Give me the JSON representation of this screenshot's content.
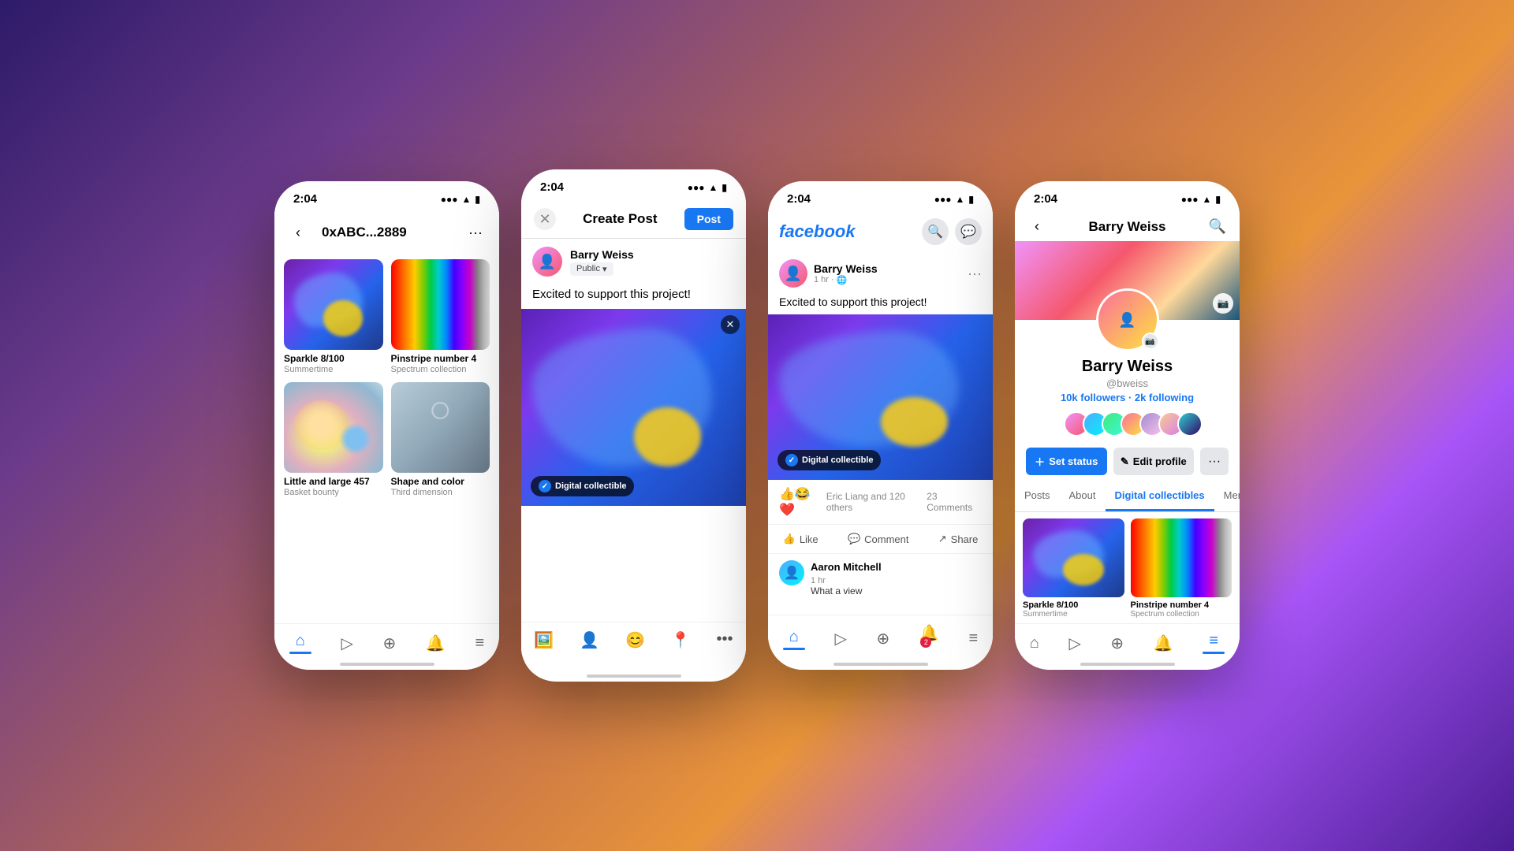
{
  "phones": {
    "phone1": {
      "status_time": "2:04",
      "title": "0xABC...2889",
      "nfts": [
        {
          "title": "Sparkle 8/100",
          "subtitle": "Summertime",
          "type": "blob"
        },
        {
          "title": "Pinstripe number 4",
          "subtitle": "Spectrum collection",
          "type": "stripes"
        },
        {
          "title": "Little and large 457",
          "subtitle": "Basket bounty",
          "type": "orbs"
        },
        {
          "title": "Shape and color",
          "subtitle": "Third dimension",
          "type": "shape"
        }
      ]
    },
    "phone2": {
      "status_time": "2:04",
      "header_title": "Create Post",
      "post_btn": "Post",
      "author_name": "Barry Weiss",
      "audience": "Public",
      "post_text": "Excited to support this project!",
      "digital_collectible": "Digital collectible",
      "action_icons": [
        "🖼️",
        "👤",
        "😊",
        "📍",
        "•••"
      ]
    },
    "phone3": {
      "status_time": "2:04",
      "logo": "facebook",
      "author_name": "Barry Weiss",
      "post_time": "1 hr",
      "post_text": "Excited to support this project!",
      "digital_collectible": "Digital collectible",
      "reactions": "🔵🤣❤️",
      "reaction_count": "Eric Liang and 120 others",
      "comment_count": "23 Comments",
      "like_label": "Like",
      "comment_label": "Comment",
      "share_label": "Share",
      "commenter_name": "Aaron Mitchell",
      "comment_time": "1 hr",
      "comment_preview": "What a view"
    },
    "phone4": {
      "status_time": "2:04",
      "profile_name": "Barry Weiss",
      "username": "@bweiss",
      "followers": "10k",
      "following": "2k",
      "followers_label": "followers",
      "following_label": "following",
      "set_status_label": "Set status",
      "edit_profile_label": "Edit profile",
      "tabs": [
        "Posts",
        "About",
        "Digital collectibles",
        "Mentions"
      ],
      "active_tab": "Digital collectibles",
      "nfts": [
        {
          "title": "Sparkle 8/100",
          "subtitle": "Summertime",
          "type": "blob"
        },
        {
          "title": "Pinstripe number 4",
          "subtitle": "Spectrum collection",
          "type": "stripes"
        }
      ]
    }
  }
}
